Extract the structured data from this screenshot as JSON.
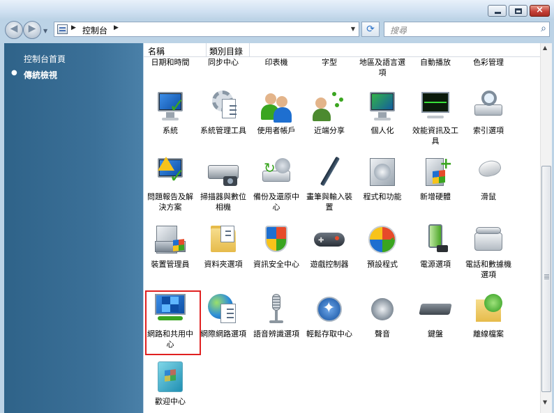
{
  "window": {
    "close_glyph": "×"
  },
  "nav": {
    "address_crumb": "控制台",
    "refresh_glyph": "⟳",
    "search_placeholder": "搜尋",
    "search_glyph": "⌕"
  },
  "left_pane": {
    "home_link": "控制台首頁",
    "classic_view": "傳統檢視"
  },
  "columns": {
    "name": "名稱",
    "category": "類別目錄"
  },
  "top_row_partial": [
    "日期和時間",
    "同步中心",
    "印表機",
    "字型",
    "地區及語言選項",
    "自動播放",
    "色彩管理"
  ],
  "items_row1": [
    "系統",
    "系統管理工具",
    "使用者帳戶",
    "近端分享",
    "個人化",
    "效能資訊及工具",
    "索引選項"
  ],
  "items_row2": [
    "問題報告及解決方案",
    "掃描器與數位相機",
    "備份及還原中心",
    "畫筆與輸入裝置",
    "程式和功能",
    "新增硬體",
    "滑鼠"
  ],
  "items_row3": [
    "裝置管理員",
    "資料夾選項",
    "資訊安全中心",
    "遊戲控制器",
    "預設程式",
    "電源選項",
    "電話和數據機選項"
  ],
  "items_row4": [
    "網路和共用中心",
    "網際網路選項",
    "語音辨識選項",
    "輕鬆存取中心",
    "聲音",
    "鍵盤",
    "離線檔案"
  ],
  "items_row5": [
    "歡迎中心"
  ],
  "colors": {
    "left_pane": "#3b6f97",
    "selection_border": "#e02020",
    "titlebar": "#cfe0f1"
  }
}
